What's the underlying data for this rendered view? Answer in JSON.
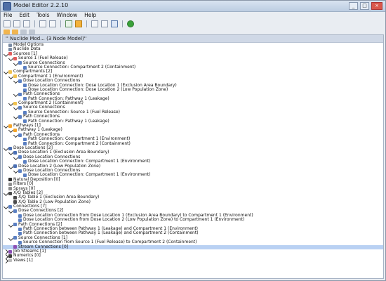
{
  "window": {
    "title": "Model Editor 2.2.10"
  },
  "menu": [
    "File",
    "Edit",
    "Tools",
    "Window",
    "Help"
  ],
  "panel": {
    "tab_label": "'' Nuclide Mod... (3 Node Model)''"
  },
  "tree": [
    {
      "label": "Model Options",
      "level": 0,
      "icon": "doc",
      "tog": null
    },
    {
      "label": "Nuclide Data",
      "level": 0,
      "icon": "doc",
      "tog": null
    },
    {
      "label": "Sources [1]",
      "level": 0,
      "icon": "src",
      "tog": "exp"
    },
    {
      "label": "Source 1 (Fuel Release)",
      "level": 1,
      "icon": "src",
      "tog": "exp"
    },
    {
      "label": "Source Connections",
      "level": 2,
      "icon": "conn",
      "tog": "exp"
    },
    {
      "label": "Source Connection: Compartment 2 (Containment)",
      "level": 3,
      "icon": "conn",
      "tog": null
    },
    {
      "label": "Compartments [2]",
      "level": 0,
      "icon": "comp",
      "tog": "exp"
    },
    {
      "label": "Compartment 1 (Environment)",
      "level": 1,
      "icon": "comp",
      "tog": "exp"
    },
    {
      "label": "Dose Location Connections",
      "level": 2,
      "icon": "conn",
      "tog": "exp"
    },
    {
      "label": "Dose Location Connection: Dose Location 1 (Exclusion Area Boundary)",
      "level": 3,
      "icon": "conn",
      "tog": null
    },
    {
      "label": "Dose Location Connection: Dose Location 2 (Low Population Zone)",
      "level": 3,
      "icon": "conn",
      "tog": null
    },
    {
      "label": "Path Connections",
      "level": 2,
      "icon": "conn",
      "tog": "exp"
    },
    {
      "label": "Path Connection: Pathway 1 (Leakage)",
      "level": 3,
      "icon": "conn",
      "tog": null
    },
    {
      "label": "Compartment 2 (Containment)",
      "level": 1,
      "icon": "comp",
      "tog": "exp"
    },
    {
      "label": "Source Connections",
      "level": 2,
      "icon": "conn",
      "tog": "exp"
    },
    {
      "label": "Source Connection: Source 1 (Fuel Release)",
      "level": 3,
      "icon": "conn",
      "tog": null
    },
    {
      "label": "Path Connections",
      "level": 2,
      "icon": "conn",
      "tog": "exp"
    },
    {
      "label": "Path Connection: Pathway 1 (Leakage)",
      "level": 3,
      "icon": "conn",
      "tog": null
    },
    {
      "label": "Pathways [1]",
      "level": 0,
      "icon": "path",
      "tog": "exp"
    },
    {
      "label": "Pathway 1 (Leakage)",
      "level": 1,
      "icon": "path",
      "tog": "exp"
    },
    {
      "label": "Path Connections",
      "level": 2,
      "icon": "conn",
      "tog": "exp"
    },
    {
      "label": "Path Connection: Compartment 1 (Environment)",
      "level": 3,
      "icon": "conn",
      "tog": null
    },
    {
      "label": "Path Connection: Compartment 2 (Containment)",
      "level": 3,
      "icon": "conn",
      "tog": null
    },
    {
      "label": "Dose Locations [2]",
      "level": 0,
      "icon": "dose",
      "tog": "exp"
    },
    {
      "label": "Dose Location 1 (Exclusion Area Boundary)",
      "level": 1,
      "icon": "dose",
      "tog": "exp"
    },
    {
      "label": "Dose Location Connections",
      "level": 2,
      "icon": "conn",
      "tog": "exp"
    },
    {
      "label": "Dose Location Connection: Compartment 1 (Environment)",
      "level": 3,
      "icon": "conn",
      "tog": null
    },
    {
      "label": "Dose Location 2 (Low Population Zone)",
      "level": 1,
      "icon": "dose",
      "tog": "exp"
    },
    {
      "label": "Dose Location Connections",
      "level": 2,
      "icon": "conn",
      "tog": "exp"
    },
    {
      "label": "Dose Location Connection: Compartment 1 (Environment)",
      "level": 3,
      "icon": "conn",
      "tog": null
    },
    {
      "label": "Natural Deposition [0]",
      "level": 0,
      "icon": "nat",
      "tog": null
    },
    {
      "label": "Filters [0]",
      "level": 0,
      "icon": "ops",
      "tog": null
    },
    {
      "label": "Sprays [0]",
      "level": 0,
      "icon": "ops",
      "tog": null
    },
    {
      "label": "X/Q Tables [2]",
      "level": 0,
      "icon": "tbl",
      "tog": "exp"
    },
    {
      "label": "X/Q Table 1 (Exclusion Area Boundary)",
      "level": 1,
      "icon": "tbl",
      "tog": null
    },
    {
      "label": "X/Q Table 2 (Low Population Zone)",
      "level": 1,
      "icon": "tbl",
      "tog": null
    },
    {
      "label": "Connections [7]",
      "level": 0,
      "icon": "conn",
      "tog": "exp"
    },
    {
      "label": "Dose Connections [2]",
      "level": 1,
      "icon": "conn",
      "tog": "exp"
    },
    {
      "label": "Dose Location Connection from Dose Location 1 (Exclusion Area Boundary) to Compartment 1 (Environment)",
      "level": 2,
      "icon": "conn",
      "tog": null
    },
    {
      "label": "Dose Location Connection from Dose Location 2 (Low Population Zone) to Compartment 1 (Environment)",
      "level": 2,
      "icon": "conn",
      "tog": null
    },
    {
      "label": "Path Connections [2]",
      "level": 1,
      "icon": "conn",
      "tog": "exp"
    },
    {
      "label": "Path Connection between Pathway 1 (Leakage) and Compartment 1 (Environment)",
      "level": 2,
      "icon": "conn",
      "tog": null
    },
    {
      "label": "Path Connection between Pathway 1 (Leakage) and Compartment 2 (Containment)",
      "level": 2,
      "icon": "conn",
      "tog": null
    },
    {
      "label": "Source Connections [1]",
      "level": 1,
      "icon": "conn",
      "tog": "exp"
    },
    {
      "label": "Source Connection from Source 1 (Fuel Release) to Compartment 2 (Containment)",
      "level": 2,
      "icon": "conn",
      "tog": null
    },
    {
      "label": "Stream Connections [0]",
      "level": 1,
      "icon": "str",
      "tog": null,
      "selected": true
    },
    {
      "label": "Job Streams [1]",
      "level": 0,
      "icon": "str",
      "tog": "col"
    },
    {
      "label": "Numerics [0]",
      "level": 0,
      "icon": "num",
      "tog": "col"
    },
    {
      "label": "Views [1]",
      "level": 0,
      "icon": "view",
      "tog": "col"
    }
  ]
}
